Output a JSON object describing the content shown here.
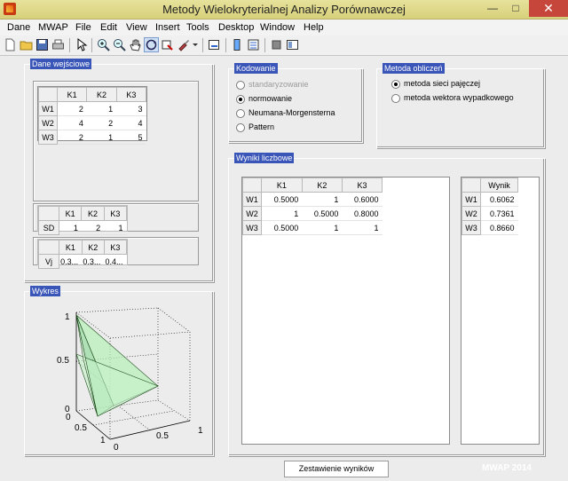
{
  "window": {
    "title": "Metody Wielokryterialnej Analizy Porównawczej",
    "minimize": "—",
    "maximize": "□",
    "close": "✕"
  },
  "menu": [
    "Dane",
    "MWAP",
    "File",
    "Edit",
    "View",
    "Insert",
    "Tools",
    "Desktop",
    "Window",
    "Help"
  ],
  "toolbar": [
    "new-file-icon",
    "open-folder-icon",
    "save-icon",
    "print-icon",
    "pointer-icon",
    "zoom-in-icon",
    "zoom-out-icon",
    "pan-hand-icon",
    "rotate-3d-icon",
    "data-cursor-icon",
    "brush-icon",
    "brush-dropdown-icon",
    "link-plot-icon",
    "insert-colorbar-icon",
    "insert-legend-icon",
    "hide-plot-tools-icon",
    "show-plot-tools-icon"
  ],
  "dane": {
    "title": "Dane wejściowe",
    "headers": [
      "K1",
      "K2",
      "K3"
    ],
    "rows": [
      {
        "label": "W1",
        "values": [
          "2",
          "1",
          "3"
        ]
      },
      {
        "label": "W2",
        "values": [
          "4",
          "2",
          "4"
        ]
      },
      {
        "label": "W3",
        "values": [
          "2",
          "1",
          "5"
        ]
      }
    ],
    "sd": {
      "headers": [
        "K1",
        "K2",
        "K3"
      ],
      "label": "SD",
      "values": [
        "1",
        "2",
        "1"
      ]
    },
    "vj": {
      "headers": [
        "K1",
        "K2",
        "K3"
      ],
      "label": "Vj",
      "values": [
        "0.3...",
        "0.3...",
        "0.4..."
      ]
    }
  },
  "kodowanie": {
    "title": "Kodowanie",
    "options": [
      {
        "label": "standaryzowanie",
        "selected": false,
        "disabled": true
      },
      {
        "label": "normowanie",
        "selected": true,
        "disabled": false
      },
      {
        "label": "Neumana-Morgensterna",
        "selected": false,
        "disabled": false
      },
      {
        "label": "Pattern",
        "selected": false,
        "disabled": false
      }
    ]
  },
  "metoda": {
    "title": "Metoda obliczeń",
    "options": [
      {
        "label": "metoda sieci pajęczej",
        "selected": true
      },
      {
        "label": "metoda wektora wypadkowego",
        "selected": false
      }
    ]
  },
  "wyniki": {
    "title": "Wyniki liczbowe",
    "headers": [
      "K1",
      "K2",
      "K3"
    ],
    "rows": [
      {
        "label": "W1",
        "values": [
          "0.5000",
          "1",
          "0.6000"
        ]
      },
      {
        "label": "W2",
        "values": [
          "1",
          "0.5000",
          "0.8000"
        ]
      },
      {
        "label": "W3",
        "values": [
          "0.5000",
          "1",
          "1"
        ]
      }
    ],
    "wynik_header": "Wynik",
    "wynik_rows": [
      {
        "label": "W1",
        "value": "0.6062"
      },
      {
        "label": "W2",
        "value": "0.7361"
      },
      {
        "label": "W3",
        "value": "0.8660"
      }
    ]
  },
  "wykres": {
    "title": "Wykres",
    "z_ticks": [
      "1",
      "0.5",
      "0"
    ],
    "x_ticks": [
      "0",
      "0.5",
      "1"
    ],
    "y_ticks": [
      "0",
      "0.5",
      "1"
    ],
    "fill_color": "#b6f0b8"
  },
  "footer": {
    "button": "Zestawienie wyników",
    "brand": "MWAP  2014"
  }
}
